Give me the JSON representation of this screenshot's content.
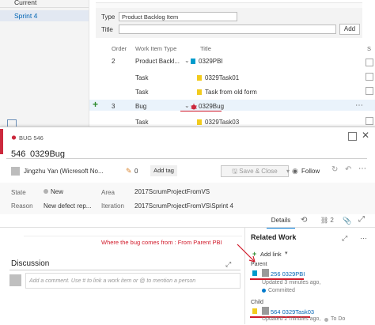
{
  "sidebar": {
    "items": [
      {
        "label": "Current"
      },
      {
        "label": "Sprint 4"
      }
    ]
  },
  "add_panel": {
    "type_label": "Type",
    "type_value": "Product Backlog Item",
    "title_label": "Title",
    "add_button": "Add"
  },
  "backlog": {
    "headers": {
      "order": "Order",
      "work_item_type": "Work Item Type",
      "title": "Title"
    },
    "rows": [
      {
        "order": "2",
        "type": "Product Backl...",
        "title": "0329PBI"
      },
      {
        "order": "",
        "type": "Task",
        "title": "0329Task01"
      },
      {
        "order": "",
        "type": "Task",
        "title": "Task from old form"
      },
      {
        "order": "3",
        "type": "Bug",
        "title": "0329Bug"
      },
      {
        "order": "",
        "type": "Task",
        "title": "0329Task03"
      }
    ]
  },
  "work_item": {
    "type_badge": "BUG 546",
    "id": "546",
    "title": "0329Bug",
    "assigned_to": "Jingzhu Yan (Wicresoft No...",
    "comments_count": "0",
    "add_tag": "Add tag",
    "save_close": "Save & Close",
    "follow": "Follow",
    "fields": {
      "state_label": "State",
      "state_value": "New",
      "area_label": "Area",
      "area_value": "2017ScrumProjectFromVS",
      "reason_label": "Reason",
      "reason_value": "New defect rep...",
      "iteration_label": "Iteration",
      "iteration_value": "2017ScrumProjectFromVS\\Sprint 4"
    },
    "tabs": {
      "details": "Details",
      "links_count": "2"
    },
    "discussion": {
      "heading": "Discussion",
      "placeholder": "Add a comment. Use # to link a work item or @ to mention a person"
    },
    "related_work": {
      "heading": "Related Work",
      "add_link": "Add link",
      "annotation": "Where the bug comes from : From Parent PBI",
      "parent_label": "Parent",
      "parent_item": "256 0329PBI",
      "parent_updated": "Updated 3 minutes ago,",
      "parent_state": "Committed",
      "child_label": "Child",
      "child_item": "564 0329Task03",
      "child_updated": "Updated 2 minutes ago,",
      "child_state": "To Do"
    }
  },
  "colors": {
    "bug_red": "#cc293d",
    "accent_blue": "#0078d4",
    "pbi_blue": "#009ccc",
    "task_yellow": "#f2cb1d",
    "committed_blue": "#007acc",
    "annotation_red": "#d11a2a"
  }
}
